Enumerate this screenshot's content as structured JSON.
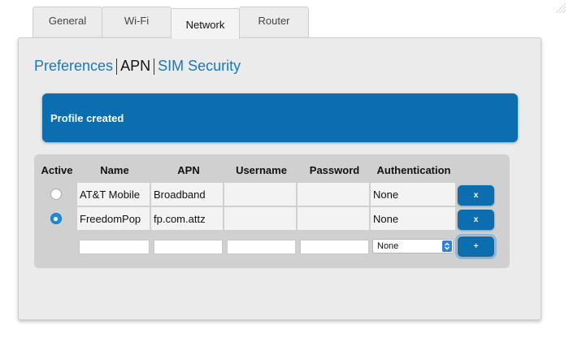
{
  "tabs": [
    {
      "label": "General",
      "active": false
    },
    {
      "label": "Wi-Fi",
      "active": false
    },
    {
      "label": "Network",
      "active": true
    },
    {
      "label": "Router",
      "active": false
    }
  ],
  "subnav": {
    "preferences": "Preferences",
    "apn": "APN",
    "sim_security": "SIM Security"
  },
  "banner": {
    "message": "Profile created"
  },
  "table": {
    "headers": [
      "Active",
      "Name",
      "APN",
      "Username",
      "Password",
      "Authentication"
    ],
    "rows": [
      {
        "active": false,
        "name": "AT&T Mobile",
        "apn": "Broadband",
        "username": "",
        "password": "",
        "authentication": "None",
        "delete_label": "x"
      },
      {
        "active": true,
        "name": "FreedomPop",
        "apn": "fp.com.attz",
        "username": "",
        "password": "",
        "authentication": "None",
        "delete_label": "x"
      }
    ],
    "new_row": {
      "name": "",
      "apn": "",
      "username": "",
      "password": "",
      "authentication": "None",
      "authentication_options": [
        "None"
      ],
      "add_label": "+"
    }
  },
  "colors": {
    "accent": "#0c6eaf",
    "link": "#1a78b8",
    "radio_on": "#1a8de0"
  }
}
